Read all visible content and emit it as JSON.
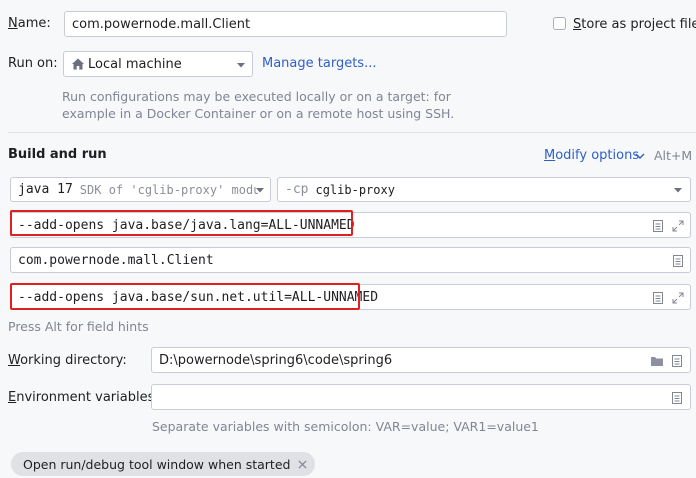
{
  "name": {
    "label": "Name:",
    "value": "com.powernode.mall.Client"
  },
  "store_as_project_file": {
    "label": "Store as project file",
    "checked": false
  },
  "run_on": {
    "label": "Run on:",
    "selected": "Local machine",
    "manage_targets": "Manage targets...",
    "description_line1": "Run configurations may be executed locally or on a target: for",
    "description_line2": "example in a Docker Container or on a remote host using SSH."
  },
  "build_and_run": {
    "title": "Build and run",
    "modify_options": "Modify options",
    "modify_shortcut": "Alt+M",
    "sdk": {
      "name": "java 17",
      "detail": "SDK of 'cglib-proxy' modu"
    },
    "classpath": {
      "prefix": "-cp",
      "module": "cglib-proxy"
    },
    "vm_options": "--add-opens java.base/java.lang=ALL-UNNAMED",
    "main_class": "com.powernode.mall.Client",
    "program_arguments": "--add-opens java.base/sun.net.util=ALL-UNNAMED",
    "field_hint": "Press Alt for field hints"
  },
  "working_directory": {
    "label": "Working directory:",
    "value": "D:\\powernode\\spring6\\code\\spring6"
  },
  "environment_variables": {
    "label": "Environment variables:",
    "value": "",
    "hint": "Separate variables with semicolon: VAR=value; VAR1=value1"
  },
  "open_tool_window_chip": {
    "label": "Open run/debug tool window when started"
  },
  "colors": {
    "accent": "#2f5fc6",
    "highlight_border": "#e0201e",
    "background": "#f7f8fa"
  }
}
